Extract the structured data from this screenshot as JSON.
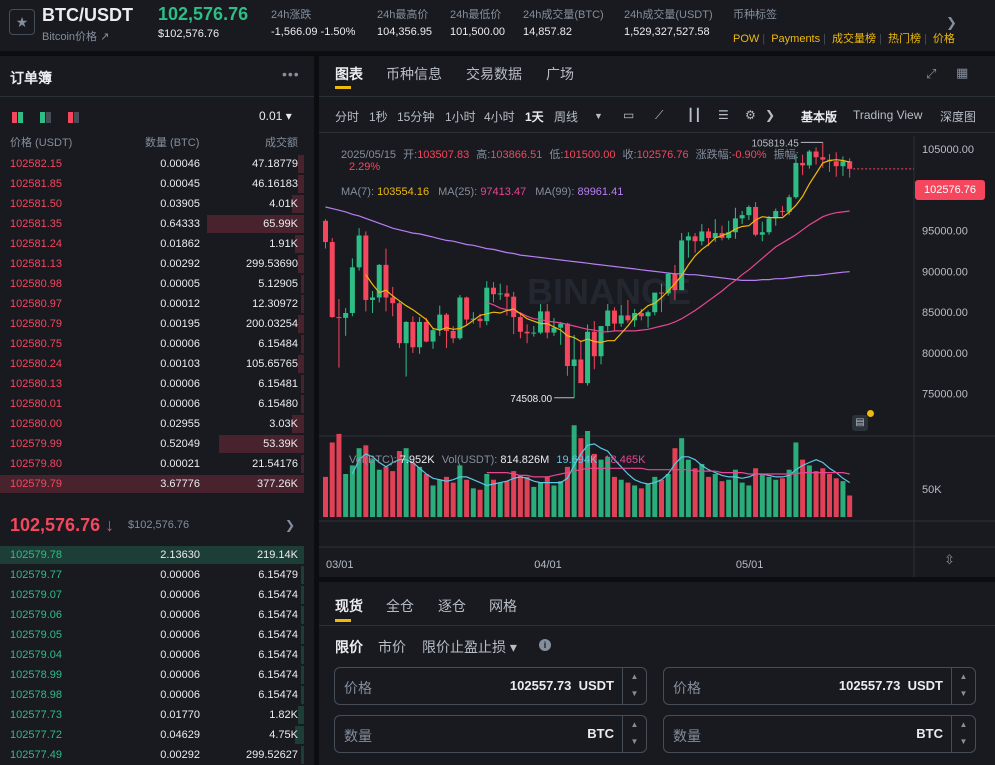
{
  "header": {
    "pair": "BTC/USDT",
    "pair_sub": "Bitcoin价格 ↗",
    "last_price": "102,576.76",
    "last_price_usd": "$102,576.76",
    "stats": [
      {
        "label": "24h涨跌",
        "value": "-1,566.09 -1.50%",
        "color": "#f6465d"
      },
      {
        "label": "24h最高价",
        "value": "104,356.95",
        "color": "#eaecef"
      },
      {
        "label": "24h最低价",
        "value": "101,500.00",
        "color": "#eaecef"
      },
      {
        "label": "24h成交量(BTC)",
        "value": "14,857.82",
        "color": "#eaecef"
      },
      {
        "label": "24h成交量(USDT)",
        "value": "1,529,327,527.58",
        "color": "#eaecef"
      }
    ],
    "tags_label": "币种标签",
    "tags": [
      "POW",
      "Payments",
      "成交量榜",
      "热门榜",
      "价格"
    ]
  },
  "orderbook": {
    "title": "订单簿",
    "tick": "0.01 ▾",
    "headers": {
      "price": "价格 (USDT)",
      "qty": "数量 (BTC)",
      "total": "成交额"
    },
    "asks": [
      {
        "p": "102582.15",
        "q": "0.00046",
        "t": "47.18779",
        "depth": 0.02
      },
      {
        "p": "102581.85",
        "q": "0.00045",
        "t": "46.16183",
        "depth": 0.02
      },
      {
        "p": "102581.50",
        "q": "0.03905",
        "t": "4.01K",
        "depth": 0.04
      },
      {
        "p": "102581.35",
        "q": "0.64333",
        "t": "65.99K",
        "depth": 0.32
      },
      {
        "p": "102581.24",
        "q": "0.01862",
        "t": "1.91K",
        "depth": 0.03
      },
      {
        "p": "102581.13",
        "q": "0.00292",
        "t": "299.53690",
        "depth": 0.02
      },
      {
        "p": "102580.98",
        "q": "0.00005",
        "t": "5.12905",
        "depth": 0.01
      },
      {
        "p": "102580.97",
        "q": "0.00012",
        "t": "12.30972",
        "depth": 0.01
      },
      {
        "p": "102580.79",
        "q": "0.00195",
        "t": "200.03254",
        "depth": 0.02
      },
      {
        "p": "102580.75",
        "q": "0.00006",
        "t": "6.15484",
        "depth": 0.01
      },
      {
        "p": "102580.24",
        "q": "0.00103",
        "t": "105.65765",
        "depth": 0.02
      },
      {
        "p": "102580.13",
        "q": "0.00006",
        "t": "6.15481",
        "depth": 0.01
      },
      {
        "p": "102580.01",
        "q": "0.00006",
        "t": "6.15480",
        "depth": 0.01
      },
      {
        "p": "102580.00",
        "q": "0.02955",
        "t": "3.03K",
        "depth": 0.04
      },
      {
        "p": "102579.99",
        "q": "0.52049",
        "t": "53.39K",
        "depth": 0.28
      },
      {
        "p": "102579.80",
        "q": "0.00021",
        "t": "21.54176",
        "depth": 0.01
      },
      {
        "p": "102579.79",
        "q": "3.67776",
        "t": "377.26K",
        "depth": 1.0
      }
    ],
    "mid_price": "102,576.76",
    "mid_arrow": "↓",
    "mid_usd": "$102,576.76",
    "bids": [
      {
        "p": "102579.78",
        "q": "2.13630",
        "t": "219.14K",
        "depth": 1.0
      },
      {
        "p": "102579.77",
        "q": "0.00006",
        "t": "6.15479",
        "depth": 0.01
      },
      {
        "p": "102579.07",
        "q": "0.00006",
        "t": "6.15474",
        "depth": 0.01
      },
      {
        "p": "102579.06",
        "q": "0.00006",
        "t": "6.15474",
        "depth": 0.01
      },
      {
        "p": "102579.05",
        "q": "0.00006",
        "t": "6.15474",
        "depth": 0.01
      },
      {
        "p": "102579.04",
        "q": "0.00006",
        "t": "6.15474",
        "depth": 0.01
      },
      {
        "p": "102578.99",
        "q": "0.00006",
        "t": "6.15474",
        "depth": 0.01
      },
      {
        "p": "102578.98",
        "q": "0.00006",
        "t": "6.15474",
        "depth": 0.01
      },
      {
        "p": "102577.73",
        "q": "0.01770",
        "t": "1.82K",
        "depth": 0.02
      },
      {
        "p": "102577.72",
        "q": "0.04629",
        "t": "4.75K",
        "depth": 0.03
      },
      {
        "p": "102577.49",
        "q": "0.00292",
        "t": "299.52627",
        "depth": 0.01
      }
    ]
  },
  "chart_panel": {
    "tabs": [
      "图表",
      "币种信息",
      "交易数据",
      "广场"
    ],
    "timeframes": [
      "分时",
      "1秒",
      "15分钟",
      "1小时",
      "4小时",
      "1天",
      "周线"
    ],
    "active_timeframe": "1天",
    "views": [
      "基本版",
      "Trading View",
      "深度图"
    ],
    "ohlc_line1": {
      "date": "2025/05/15",
      "open_l": "开:",
      "open": "103507.83",
      "high_l": "高:",
      "high": "103866.51",
      "low_l": "低:",
      "low": "101500.00",
      "close_l": "收:",
      "close": "102576.76",
      "chg_l": "涨跌幅:",
      "chg": "-0.90%",
      "amp_l": "振幅:"
    },
    "ohlc_line2": "2.29%",
    "ma": [
      {
        "label": "MA(7):",
        "value": "103554.16",
        "color": "#f0b90b"
      },
      {
        "label": "MA(25):",
        "value": "97413.47",
        "color": "#e64693"
      },
      {
        "label": "MA(99):",
        "value": "89961.41",
        "color": "#b87ef5"
      }
    ],
    "vol": {
      "l1": "Vol(BTC):",
      "v1": "7.952K",
      "l2": "Vol(USDT):",
      "v2": "814.826M",
      "v3": "19.694K",
      "v4": "18.465K"
    },
    "watermark": "BINANCE",
    "price_tag": "102576.76",
    "high_marker": "105819.45",
    "low_marker": "74508.00"
  },
  "chart_data": {
    "type": "candlestick",
    "title": "BTC/USDT 1天",
    "y_ticks": [
      105000,
      100000,
      95000,
      90000,
      85000,
      80000,
      75000
    ],
    "ylim": [
      70800,
      106600
    ],
    "x_ticks": [
      {
        "i": 1,
        "label": "03/01"
      },
      {
        "i": 32,
        "label": "04/01"
      },
      {
        "i": 62,
        "label": "05/01"
      }
    ],
    "vol_tick": "50K",
    "vol_max": 64000,
    "series": [
      {
        "name": "MA(7)",
        "color": "#f0b90b"
      },
      {
        "name": "MA(25)",
        "color": "#e64693"
      },
      {
        "name": "MA(99)",
        "color": "#b87ef5"
      }
    ],
    "candles": [
      [
        96200,
        96400,
        92800,
        93600,
        28
      ],
      [
        93600,
        94100,
        84300,
        84400,
        52
      ],
      [
        84400,
        86600,
        78200,
        84300,
        58
      ],
      [
        84300,
        85500,
        82100,
        84900,
        30
      ],
      [
        84900,
        91600,
        84500,
        90500,
        36
      ],
      [
        90500,
        95300,
        90100,
        94400,
        48
      ],
      [
        94400,
        94900,
        85100,
        86500,
        50
      ],
      [
        86500,
        87600,
        84900,
        86800,
        40
      ],
      [
        86800,
        90900,
        86200,
        90800,
        33
      ],
      [
        90800,
        92800,
        85100,
        86800,
        35
      ],
      [
        86800,
        88100,
        84500,
        86100,
        32
      ],
      [
        86100,
        86300,
        80600,
        81200,
        46
      ],
      [
        81200,
        83900,
        77100,
        83800,
        48
      ],
      [
        83800,
        84500,
        80000,
        80700,
        38
      ],
      [
        80700,
        84400,
        79900,
        83800,
        35
      ],
      [
        83800,
        84300,
        81300,
        81400,
        30
      ],
      [
        81400,
        83100,
        80500,
        82800,
        22
      ],
      [
        82800,
        85800,
        82100,
        84700,
        26
      ],
      [
        84700,
        84900,
        80600,
        82700,
        28
      ],
      [
        82700,
        83300,
        81200,
        81800,
        24
      ],
      [
        81800,
        87100,
        81600,
        86800,
        36
      ],
      [
        86800,
        86900,
        83500,
        84100,
        26
      ],
      [
        84100,
        85000,
        83600,
        84200,
        20
      ],
      [
        84200,
        84800,
        83100,
        83900,
        19
      ],
      [
        83900,
        88800,
        83400,
        88000,
        30
      ],
      [
        88000,
        88700,
        86200,
        87200,
        26
      ],
      [
        87200,
        88500,
        86500,
        87300,
        24
      ],
      [
        87300,
        88300,
        84600,
        86900,
        25
      ],
      [
        86900,
        87500,
        82300,
        84400,
        32
      ],
      [
        84400,
        85000,
        81800,
        82600,
        29
      ],
      [
        82600,
        83500,
        81200,
        82400,
        28
      ],
      [
        82400,
        83300,
        82000,
        82500,
        21
      ],
      [
        82500,
        86000,
        82300,
        85100,
        24
      ],
      [
        85100,
        86000,
        81800,
        82500,
        28
      ],
      [
        82500,
        84300,
        82100,
        83100,
        22
      ],
      [
        83100,
        83800,
        81000,
        83600,
        25
      ],
      [
        83600,
        83700,
        77200,
        78400,
        35
      ],
      [
        78400,
        82200,
        74508,
        79200,
        64
      ],
      [
        79200,
        81500,
        76400,
        76300,
        55
      ],
      [
        76300,
        83500,
        76000,
        82600,
        60
      ],
      [
        82600,
        83900,
        78000,
        79600,
        44
      ],
      [
        79600,
        83300,
        78600,
        83300,
        40
      ],
      [
        83300,
        86000,
        82600,
        85200,
        42
      ],
      [
        85200,
        85600,
        82700,
        83600,
        28
      ],
      [
        83600,
        85900,
        83200,
        84600,
        26
      ],
      [
        84600,
        86500,
        83700,
        84000,
        24
      ],
      [
        84000,
        85400,
        83200,
        84900,
        22
      ],
      [
        84900,
        85400,
        84000,
        84500,
        20
      ],
      [
        84500,
        85200,
        83100,
        85000,
        23
      ],
      [
        85000,
        87200,
        84600,
        87400,
        28
      ],
      [
        87400,
        88500,
        85000,
        87300,
        26
      ],
      [
        87300,
        89800,
        87000,
        89700,
        30
      ],
      [
        89700,
        90800,
        86500,
        87700,
        48
      ],
      [
        87700,
        94700,
        87700,
        93800,
        55
      ],
      [
        93800,
        94800,
        91700,
        94300,
        40
      ],
      [
        94300,
        94700,
        92300,
        93700,
        34
      ],
      [
        93700,
        95800,
        93200,
        94900,
        37
      ],
      [
        94900,
        95300,
        93100,
        94100,
        28
      ],
      [
        94100,
        96400,
        93600,
        94700,
        30
      ],
      [
        94700,
        95600,
        93800,
        94100,
        25
      ],
      [
        94100,
        96200,
        93900,
        94800,
        26
      ],
      [
        94800,
        97800,
        94000,
        96500,
        33
      ],
      [
        96500,
        97400,
        95800,
        96900,
        24
      ],
      [
        96900,
        98100,
        96300,
        97900,
        22
      ],
      [
        97900,
        98500,
        94300,
        94500,
        34
      ],
      [
        94500,
        96100,
        93700,
        94800,
        30
      ],
      [
        94800,
        96800,
        94500,
        96500,
        28
      ],
      [
        96500,
        97700,
        95600,
        97400,
        26
      ],
      [
        97400,
        98000,
        96800,
        97300,
        27
      ],
      [
        97300,
        99400,
        96900,
        99100,
        33
      ],
      [
        99100,
        104400,
        98900,
        103300,
        52
      ],
      [
        103300,
        104300,
        101800,
        103000,
        40
      ],
      [
        103000,
        104900,
        102600,
        104700,
        36
      ],
      [
        104700,
        105200,
        103100,
        104000,
        32
      ],
      [
        104000,
        105819,
        102700,
        103700,
        34
      ],
      [
        103700,
        104400,
        102200,
        103500,
        30
      ],
      [
        103500,
        104600,
        101600,
        102900,
        27
      ],
      [
        102900,
        104100,
        101700,
        103500,
        25
      ],
      [
        103507,
        103866,
        101500,
        102576,
        15
      ]
    ],
    "ma7": [
      null,
      null,
      null,
      null,
      null,
      null,
      89600,
      88400,
      87400,
      87700,
      87000,
      86400,
      85800,
      85300,
      84700,
      84100,
      83000,
      82800,
      83100,
      82900,
      83000,
      83400,
      84000,
      84600,
      84800,
      85000,
      84900,
      85200,
      85400,
      84800,
      84200,
      83900,
      83600,
      83600,
      83200,
      82800,
      82100,
      81900,
      81400,
      81700,
      81400,
      81300,
      81500,
      81500,
      82400,
      83300,
      84400,
      85100,
      85800,
      86100,
      86800,
      87600,
      88500,
      89500,
      90800,
      91900,
      92700,
      93300,
      94100,
      94400,
      94700,
      95200,
      95500,
      95600,
      96300,
      96700,
      96600,
      96600,
      96600,
      97300,
      98100,
      99200,
      100700,
      102000,
      103300,
      103600,
      103700,
      103600,
      103400
    ],
    "ma25": [
      null,
      null,
      null,
      null,
      null,
      null,
      null,
      null,
      null,
      null,
      null,
      null,
      null,
      null,
      null,
      null,
      null,
      null,
      null,
      null,
      null,
      null,
      null,
      null,
      86200,
      85900,
      85500,
      85300,
      85100,
      84900,
      84500,
      84200,
      84100,
      83900,
      83800,
      83700,
      83500,
      83300,
      83100,
      82900,
      82800,
      82600,
      82600,
      82700,
      82700,
      82700,
      82700,
      82800,
      82900,
      83100,
      83300,
      83500,
      83800,
      84200,
      84700,
      85200,
      85800,
      86400,
      87000,
      87600,
      88300,
      88900,
      89600,
      90200,
      90900,
      91600,
      92300,
      93000,
      93500,
      94000,
      94500,
      95100,
      95700,
      96200,
      96700,
      97000,
      97200,
      97300,
      97400
    ],
    "ma99": [
      97900,
      97700,
      97500,
      97300,
      97000,
      96800,
      96500,
      96200,
      95900,
      95600,
      95300,
      95100,
      94900,
      94700,
      94600,
      94400,
      94200,
      94000,
      93800,
      93700,
      93500,
      93300,
      93200,
      93000,
      92800,
      92700,
      92500,
      92300,
      92200,
      92000,
      91900,
      91800,
      91700,
      91600,
      91500,
      91400,
      91300,
      91200,
      91100,
      91000,
      90900,
      90800,
      90700,
      90600,
      90500,
      90400,
      90300,
      90200,
      90100,
      90000,
      89900,
      89800,
      89700,
      89700,
      89600,
      89600,
      89500,
      89400,
      89300,
      89200,
      89100,
      89000,
      88900,
      88900,
      88900,
      89000,
      89000,
      89100,
      89100,
      89200,
      89300,
      89400,
      89500,
      89500,
      89600,
      89700,
      89800,
      89900,
      89960
    ],
    "vol_ma1": [
      null,
      null,
      null,
      null,
      30,
      40,
      44,
      42,
      38,
      35,
      38,
      40,
      40,
      38,
      34,
      30,
      27,
      26,
      25,
      26,
      28,
      28,
      26,
      24,
      22,
      23,
      24,
      25,
      27,
      28,
      27,
      25,
      24,
      24,
      24,
      24,
      27,
      36,
      44,
      50,
      51,
      48,
      46,
      40,
      35,
      30,
      26,
      24,
      23,
      24,
      26,
      30,
      37,
      42,
      42,
      40,
      36,
      33,
      31,
      29,
      28,
      28,
      27,
      28,
      30,
      30,
      29,
      28,
      28,
      29,
      33,
      36,
      38,
      40,
      38,
      34,
      31,
      27,
      24
    ],
    "vol_ma2": [
      null,
      null,
      null,
      null,
      null,
      null,
      null,
      null,
      null,
      null,
      null,
      null,
      null,
      null,
      null,
      null,
      null,
      null,
      null,
      null,
      null,
      null,
      null,
      null,
      31,
      31,
      31,
      31,
      30,
      29,
      29,
      28,
      28,
      28,
      29,
      30,
      31,
      32,
      33,
      34,
      34,
      34,
      34,
      34,
      34,
      34,
      34,
      34,
      33,
      33,
      33,
      33,
      33,
      33,
      33,
      32,
      32,
      32,
      32,
      31,
      31,
      31,
      31,
      30,
      30,
      30,
      30,
      30,
      30,
      30,
      30,
      31,
      31,
      31,
      31,
      31,
      31,
      31,
      30
    ]
  },
  "order_panel": {
    "tabs": [
      "现货",
      "全仓",
      "逐仓",
      "网格"
    ],
    "price_tabs": [
      "限价",
      "市价",
      "限价止盈止损 ▾"
    ],
    "buy": {
      "price_label": "价格",
      "price": "102557.73",
      "price_unit": "USDT",
      "qty_label": "数量",
      "qty_unit": "BTC"
    },
    "sell": {
      "price_label": "价格",
      "price": "102557.73",
      "price_unit": "USDT",
      "qty_label": "数量",
      "qty_unit": "BTC"
    }
  }
}
